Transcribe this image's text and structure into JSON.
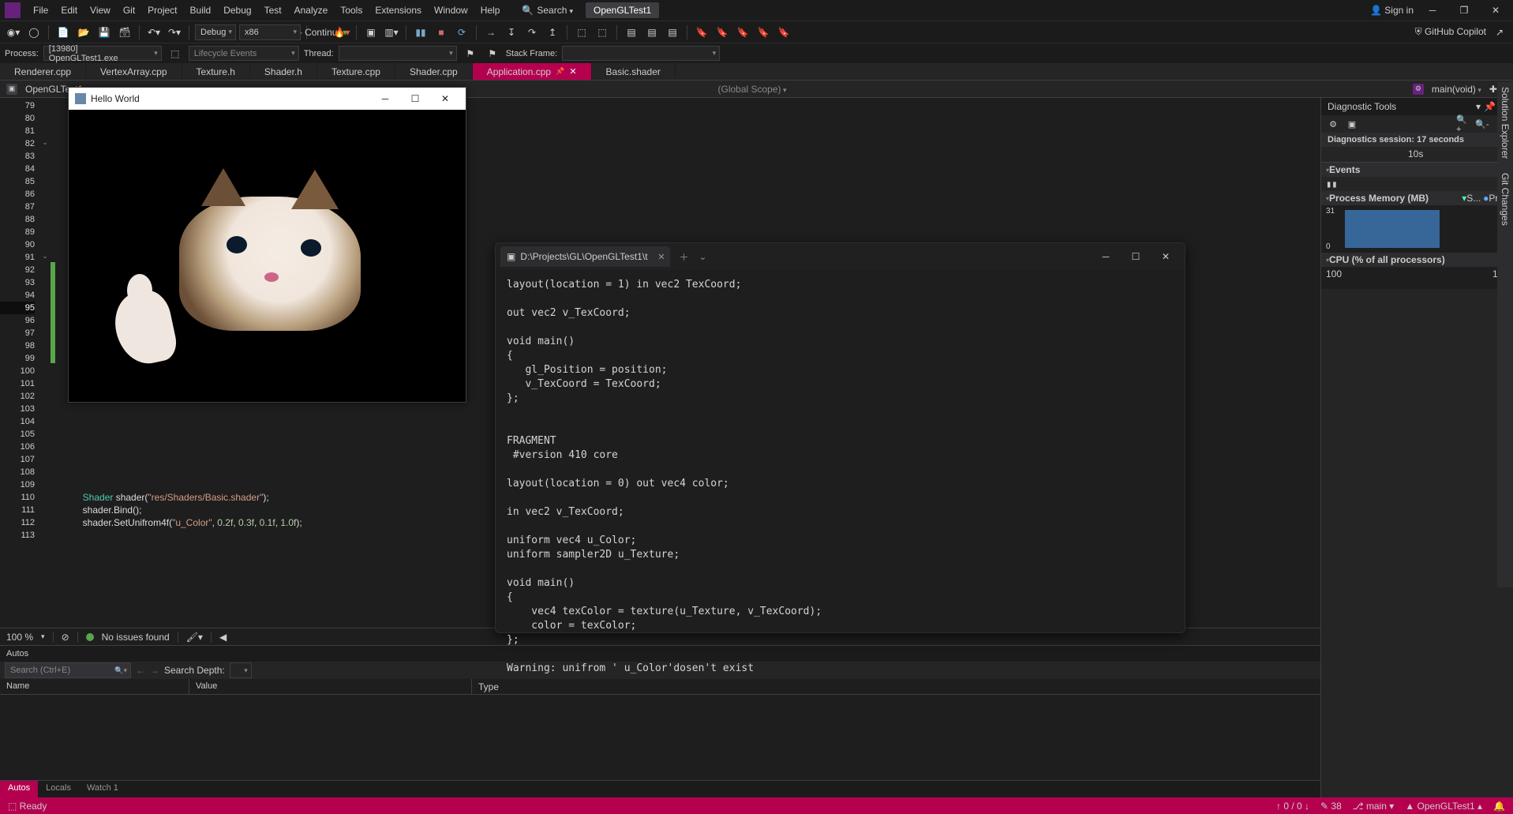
{
  "menubar": {
    "items": [
      "File",
      "Edit",
      "View",
      "Git",
      "Project",
      "Build",
      "Debug",
      "Test",
      "Analyze",
      "Tools",
      "Extensions",
      "Window",
      "Help"
    ],
    "search": "Search",
    "solution": "OpenGLTest1",
    "signin": "Sign in"
  },
  "toolbar": {
    "config": "Debug",
    "platform": "x86",
    "continue": "Continue",
    "copilot": "GitHub Copilot"
  },
  "toolbar2": {
    "process_label": "Process:",
    "process_value": "[13980] OpenGLTest1.exe",
    "lifecycle": "Lifecycle Events",
    "thread_label": "Thread:",
    "stack_label": "Stack Frame:"
  },
  "tabs": [
    {
      "label": "Renderer.cpp",
      "active": false
    },
    {
      "label": "VertexArray.cpp",
      "active": false
    },
    {
      "label": "Texture.h",
      "active": false
    },
    {
      "label": "Shader.h",
      "active": false
    },
    {
      "label": "Texture.cpp",
      "active": false
    },
    {
      "label": "Shader.cpp",
      "active": false
    },
    {
      "label": "Application.cpp",
      "active": true
    },
    {
      "label": "Basic.shader",
      "active": false
    }
  ],
  "crumb": {
    "project": "OpenGLTest1",
    "scope": "(Global Scope)",
    "func": "main(void)"
  },
  "editor": {
    "first_line": 79,
    "last_line": 113,
    "current_line": 95,
    "fold_lines": [
      82,
      91
    ],
    "green_margin_from": 92,
    "green_margin_to": 99,
    "code_lines": {
      "110": [
        [
          "type",
          "Shader"
        ],
        [
          "ident",
          " shader"
        ],
        [
          "punc",
          "("
        ],
        [
          "str",
          "\"res/Shaders/Basic.shader\""
        ],
        [
          "punc",
          ");"
        ]
      ],
      "111": [
        [
          "ident",
          "shader"
        ],
        [
          "punc",
          "."
        ],
        [
          "ident",
          "Bind"
        ],
        [
          "punc",
          "();"
        ]
      ],
      "112": [
        [
          "ident",
          "shader"
        ],
        [
          "punc",
          "."
        ],
        [
          "ident",
          "SetUnifrom4f"
        ],
        [
          "punc",
          "("
        ],
        [
          "str",
          "\"u_Color\""
        ],
        [
          "punc",
          ", "
        ],
        [
          "num",
          "0.2f"
        ],
        [
          "punc",
          ", "
        ],
        [
          "num",
          "0.3f"
        ],
        [
          "punc",
          ", "
        ],
        [
          "num",
          "0.1f"
        ],
        [
          "punc",
          ", "
        ],
        [
          "num",
          "1.0f"
        ],
        [
          "punc",
          ");"
        ]
      ]
    }
  },
  "status_strip": {
    "zoom": "100 %",
    "issues": "No issues found"
  },
  "autos": {
    "title": "Autos",
    "search_placeholder": "Search (Ctrl+E)",
    "depth_label": "Search Depth:",
    "cols": [
      "Name",
      "Value",
      "Type"
    ],
    "tabs": [
      "Autos",
      "Locals",
      "Watch 1"
    ]
  },
  "diagnostics": {
    "title": "Diagnostic Tools",
    "session": "Diagnostics session: 17 seconds",
    "ruler": [
      "10s"
    ],
    "events": "Events",
    "pm_title": "Process Memory (MB)",
    "pm_legend": [
      "S...",
      "Pri..."
    ],
    "pm_y": "31",
    "pm_y0": "0",
    "cpu_title": "CPU (% of all processors)",
    "cpu_y": "100"
  },
  "vertical_tabs": [
    "Solution Explorer",
    "Git Changes"
  ],
  "statusbar": {
    "ready": "Ready",
    "updown": "↑ 0 / 0 ↓",
    "line_indicator": "38",
    "branch": "main",
    "repo": "OpenGLTest1"
  },
  "hello_window": {
    "title": "Hello World"
  },
  "terminal": {
    "tab_title": "D:\\Projects\\GL\\OpenGLTest1\\t",
    "text": "layout(location = 1) in vec2 TexCoord;\n\nout vec2 v_TexCoord;\n\nvoid main()\n{\n   gl_Position = position;\n   v_TexCoord = TexCoord;\n};\n\n\nFRAGMENT\n #version 410 core\n\nlayout(location = 0) out vec4 color;\n\nin vec2 v_TexCoord;\n\nuniform vec4 u_Color;\nuniform sampler2D u_Texture;\n\nvoid main()\n{\n    vec4 texColor = texture(u_Texture, v_TexCoord);\n    color = texColor;\n};\n\nWarning: unifrom ' u_Color'dosen't exist"
  }
}
